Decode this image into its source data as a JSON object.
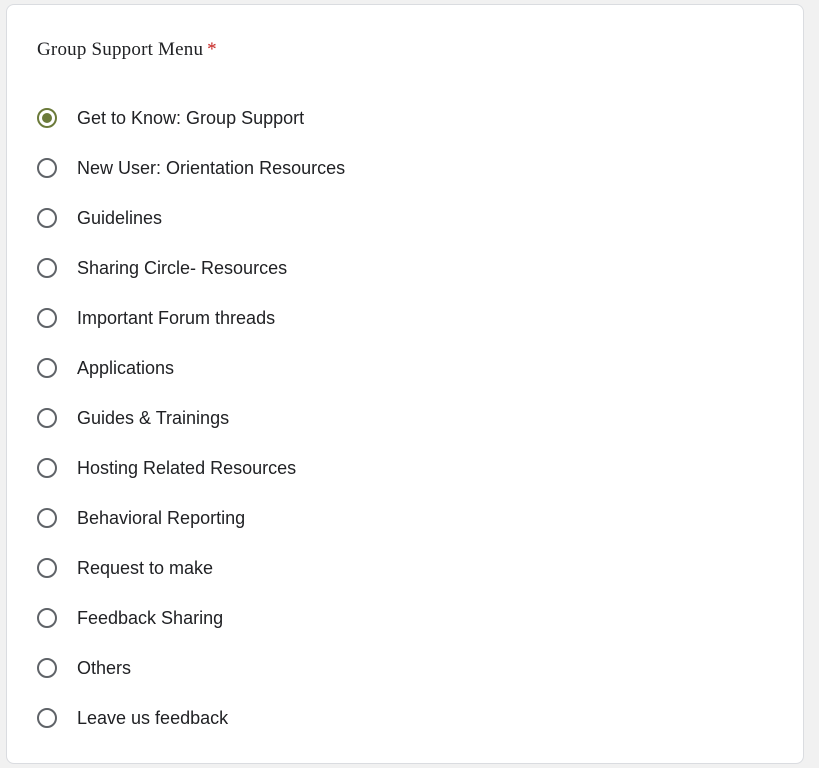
{
  "question": {
    "title": "Group Support Menu",
    "required_marker": "*",
    "accent_color": "#6b7a3a",
    "selected_index": 0
  },
  "options": [
    {
      "label": "Get to Know: Group Support",
      "selected": true
    },
    {
      "label": "New User: Orientation Resources",
      "selected": false
    },
    {
      "label": "Guidelines",
      "selected": false
    },
    {
      "label": "Sharing Circle- Resources",
      "selected": false
    },
    {
      "label": "Important Forum threads",
      "selected": false
    },
    {
      "label": "Applications",
      "selected": false
    },
    {
      "label": "Guides & Trainings",
      "selected": false
    },
    {
      "label": "Hosting Related Resources",
      "selected": false
    },
    {
      "label": "Behavioral Reporting",
      "selected": false
    },
    {
      "label": "Request to make",
      "selected": false
    },
    {
      "label": "Feedback Sharing",
      "selected": false
    },
    {
      "label": "Others",
      "selected": false
    },
    {
      "label": "Leave us feedback",
      "selected": false
    }
  ]
}
